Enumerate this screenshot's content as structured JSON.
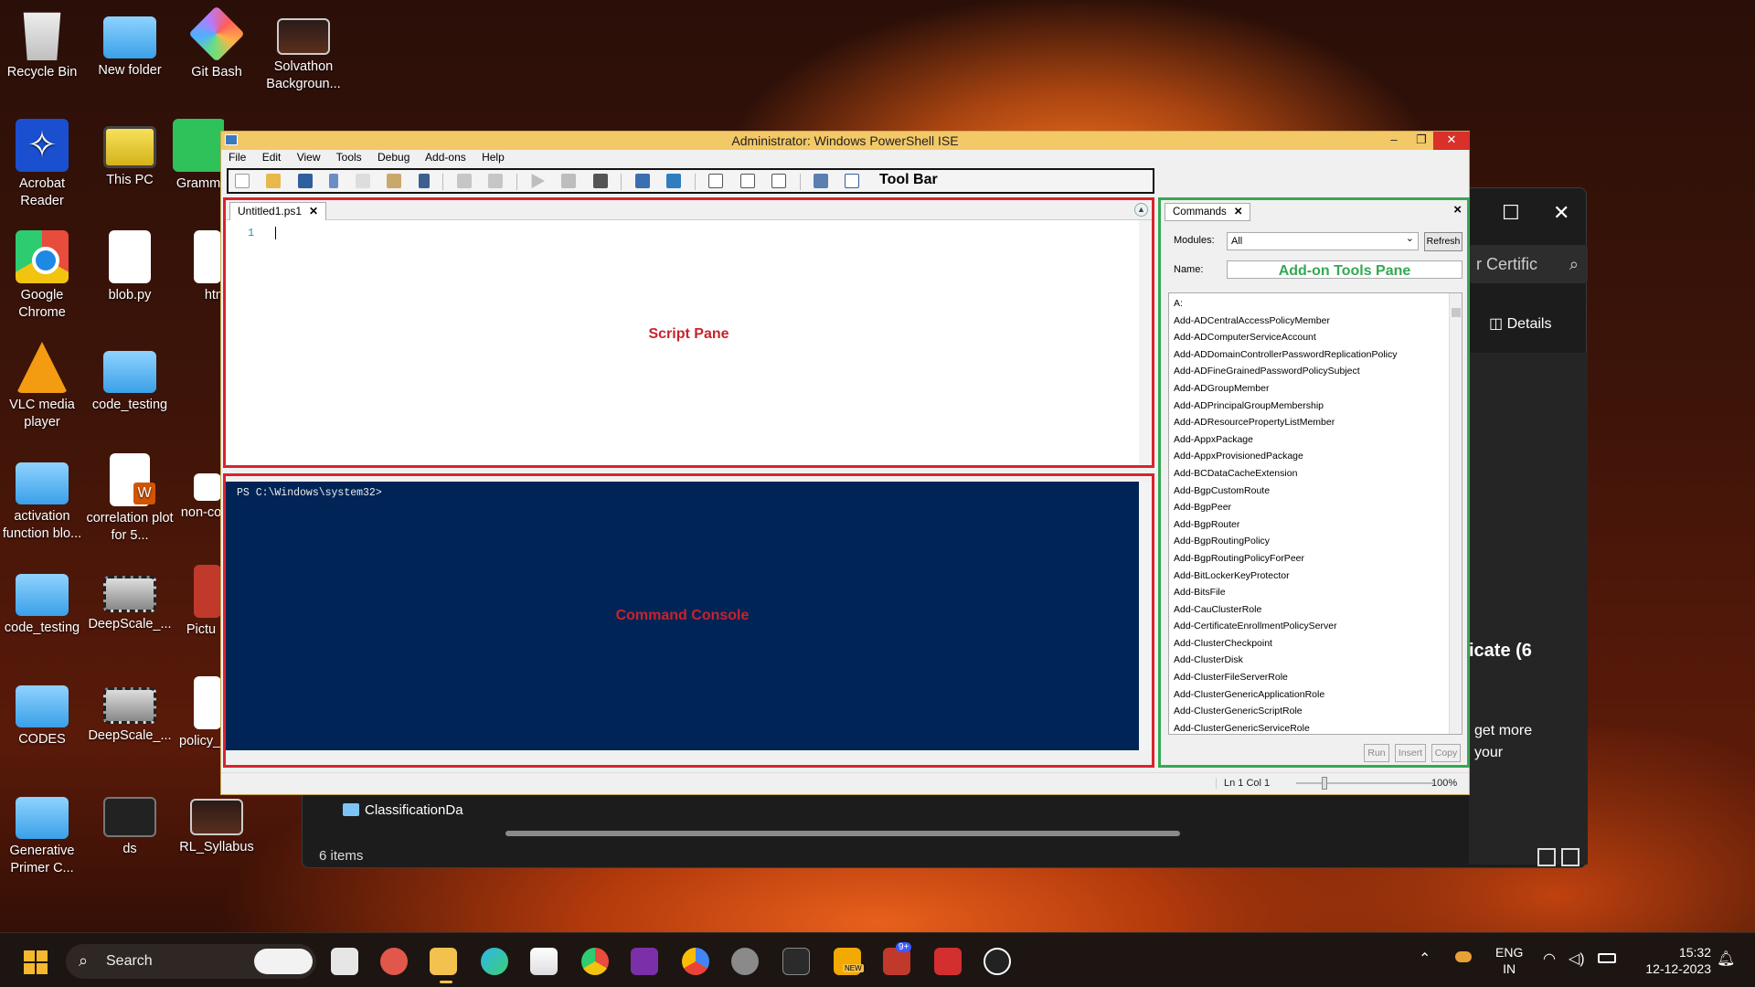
{
  "desktop": {
    "icons": [
      {
        "label": "Recycle Bin"
      },
      {
        "label": "New folder"
      },
      {
        "label": "Git Bash"
      },
      {
        "label": "Solvathon Backgroun..."
      },
      {
        "label": "Acrobat Reader"
      },
      {
        "label": "This PC"
      },
      {
        "label": "Gramm"
      },
      {
        "label": "Google Chrome"
      },
      {
        "label": "blob.py"
      },
      {
        "label": "htn"
      },
      {
        "label": "VLC media player"
      },
      {
        "label": "code_testing"
      },
      {
        "label": "activation function blo..."
      },
      {
        "label": "correlation plot for 5..."
      },
      {
        "label": "non-co"
      },
      {
        "label": "code_testing"
      },
      {
        "label": "DeepScale_..."
      },
      {
        "label": "Pictu"
      },
      {
        "label": "CODES"
      },
      {
        "label": "DeepScale_..."
      },
      {
        "label": "policy_t"
      },
      {
        "label": "Generative Primer C..."
      },
      {
        "label": "ds"
      },
      {
        "label": "RL_Syllabus"
      }
    ]
  },
  "explorer": {
    "search_text": "r Certific",
    "details_label": "Details",
    "cert_title": "icate (6",
    "get_more_line1": "get more",
    "get_more_line2": "your",
    "nav_folder": "ClassificationDa",
    "status": "6 items",
    "minimize": "—",
    "maximize": "☐",
    "close": "✕"
  },
  "ise": {
    "title": "Administrator: Windows PowerShell ISE",
    "window_buttons": {
      "minimize": "–",
      "restore": "❐",
      "close": "✕"
    },
    "menu": [
      "File",
      "Edit",
      "View",
      "Tools",
      "Debug",
      "Add-ons",
      "Help"
    ],
    "toolbar_label": "Tool Bar",
    "script_tab": "Untitled1.ps1",
    "line_number": "1",
    "script_pane_label": "Script Pane",
    "console_prompt": "PS C:\\Windows\\system32>",
    "console_label": "Command Console",
    "addon": {
      "tab": "Commands",
      "modules_label": "Modules:",
      "modules_value": "All",
      "refresh": "Refresh",
      "name_label": "Name:",
      "pane_label": "Add-on Tools Pane",
      "commands": [
        "A:",
        "Add-ADCentralAccessPolicyMember",
        "Add-ADComputerServiceAccount",
        "Add-ADDomainControllerPasswordReplicationPolicy",
        "Add-ADFineGrainedPasswordPolicySubject",
        "Add-ADGroupMember",
        "Add-ADPrincipalGroupMembership",
        "Add-ADResourcePropertyListMember",
        "Add-AppxPackage",
        "Add-AppxProvisionedPackage",
        "Add-BCDataCacheExtension",
        "Add-BgpCustomRoute",
        "Add-BgpPeer",
        "Add-BgpRouter",
        "Add-BgpRoutingPolicy",
        "Add-BgpRoutingPolicyForPeer",
        "Add-BitLockerKeyProtector",
        "Add-BitsFile",
        "Add-CauClusterRole",
        "Add-CertificateEnrollmentPolicyServer",
        "Add-ClusterCheckpoint",
        "Add-ClusterDisk",
        "Add-ClusterFileServerRole",
        "Add-ClusterGenericApplicationRole",
        "Add-ClusterGenericScriptRole",
        "Add-ClusterGenericServiceRole"
      ],
      "run": "Run",
      "insert": "Insert",
      "copy": "Copy"
    },
    "status_position": "Ln 1  Col 1",
    "zoom": "100%"
  },
  "taskbar": {
    "search_label": "Search",
    "lang_line1": "ENG",
    "lang_line2": "IN",
    "time": "15:32",
    "date": "12-12-2023",
    "badge_new": "NEW",
    "badge_count": "9+"
  }
}
